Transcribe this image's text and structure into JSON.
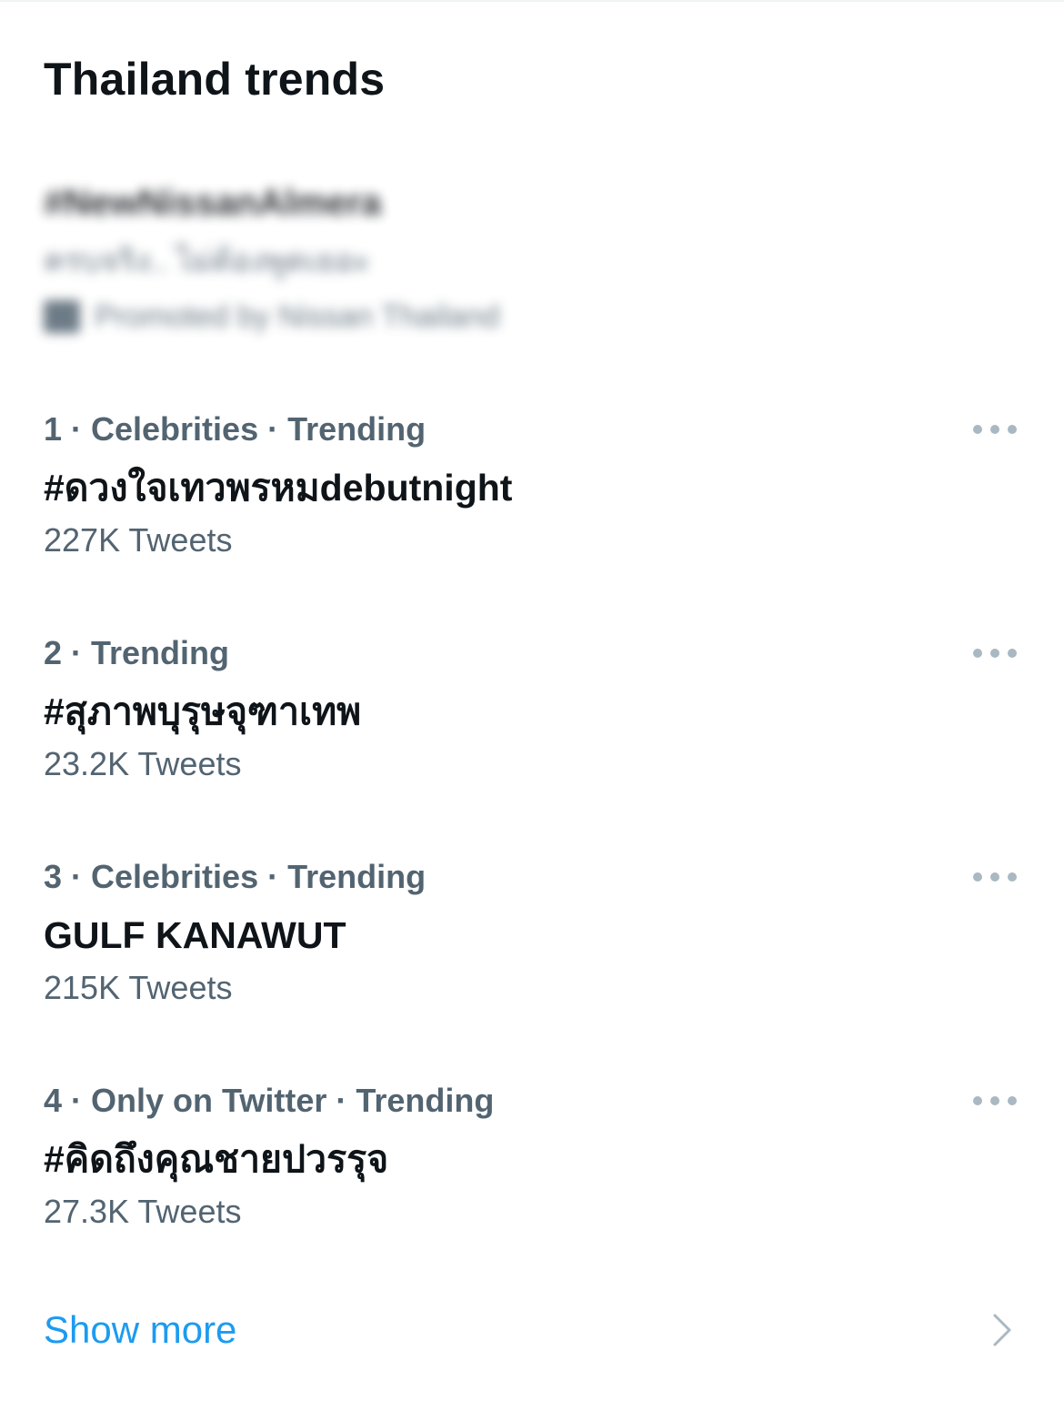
{
  "section": {
    "title": "Thailand trends"
  },
  "promoted": {
    "hashtag": "#NewNissanAlmera",
    "description": "ครบจริง.. ไม่ต้องพูดเยอะ",
    "by": "Promoted by Nissan Thailand",
    "icon": "promoted-icon",
    "blurred": true
  },
  "trends": [
    {
      "meta": "1 · Celebrities · Trending",
      "name": "#ดวงใจเทวพรหมdebutnight",
      "count": "227K Tweets"
    },
    {
      "meta": "2 · Trending",
      "name": "#สุภาพบุรุษจุฑาเทพ",
      "count": "23.2K Tweets"
    },
    {
      "meta": "3 · Celebrities · Trending",
      "name": "GULF KANAWUT",
      "count": "215K Tweets"
    },
    {
      "meta": "4 · Only on Twitter · Trending",
      "name": "#คิดถึงคุณชายปวรรุจ",
      "count": "27.3K Tweets"
    }
  ],
  "show_more": {
    "label": "Show more",
    "icon": "chevron-right-icon"
  },
  "colors": {
    "primary_text": "#0f1419",
    "secondary_text": "#536471",
    "accent": "#1d9bf0",
    "dots": "#aab8c2"
  }
}
